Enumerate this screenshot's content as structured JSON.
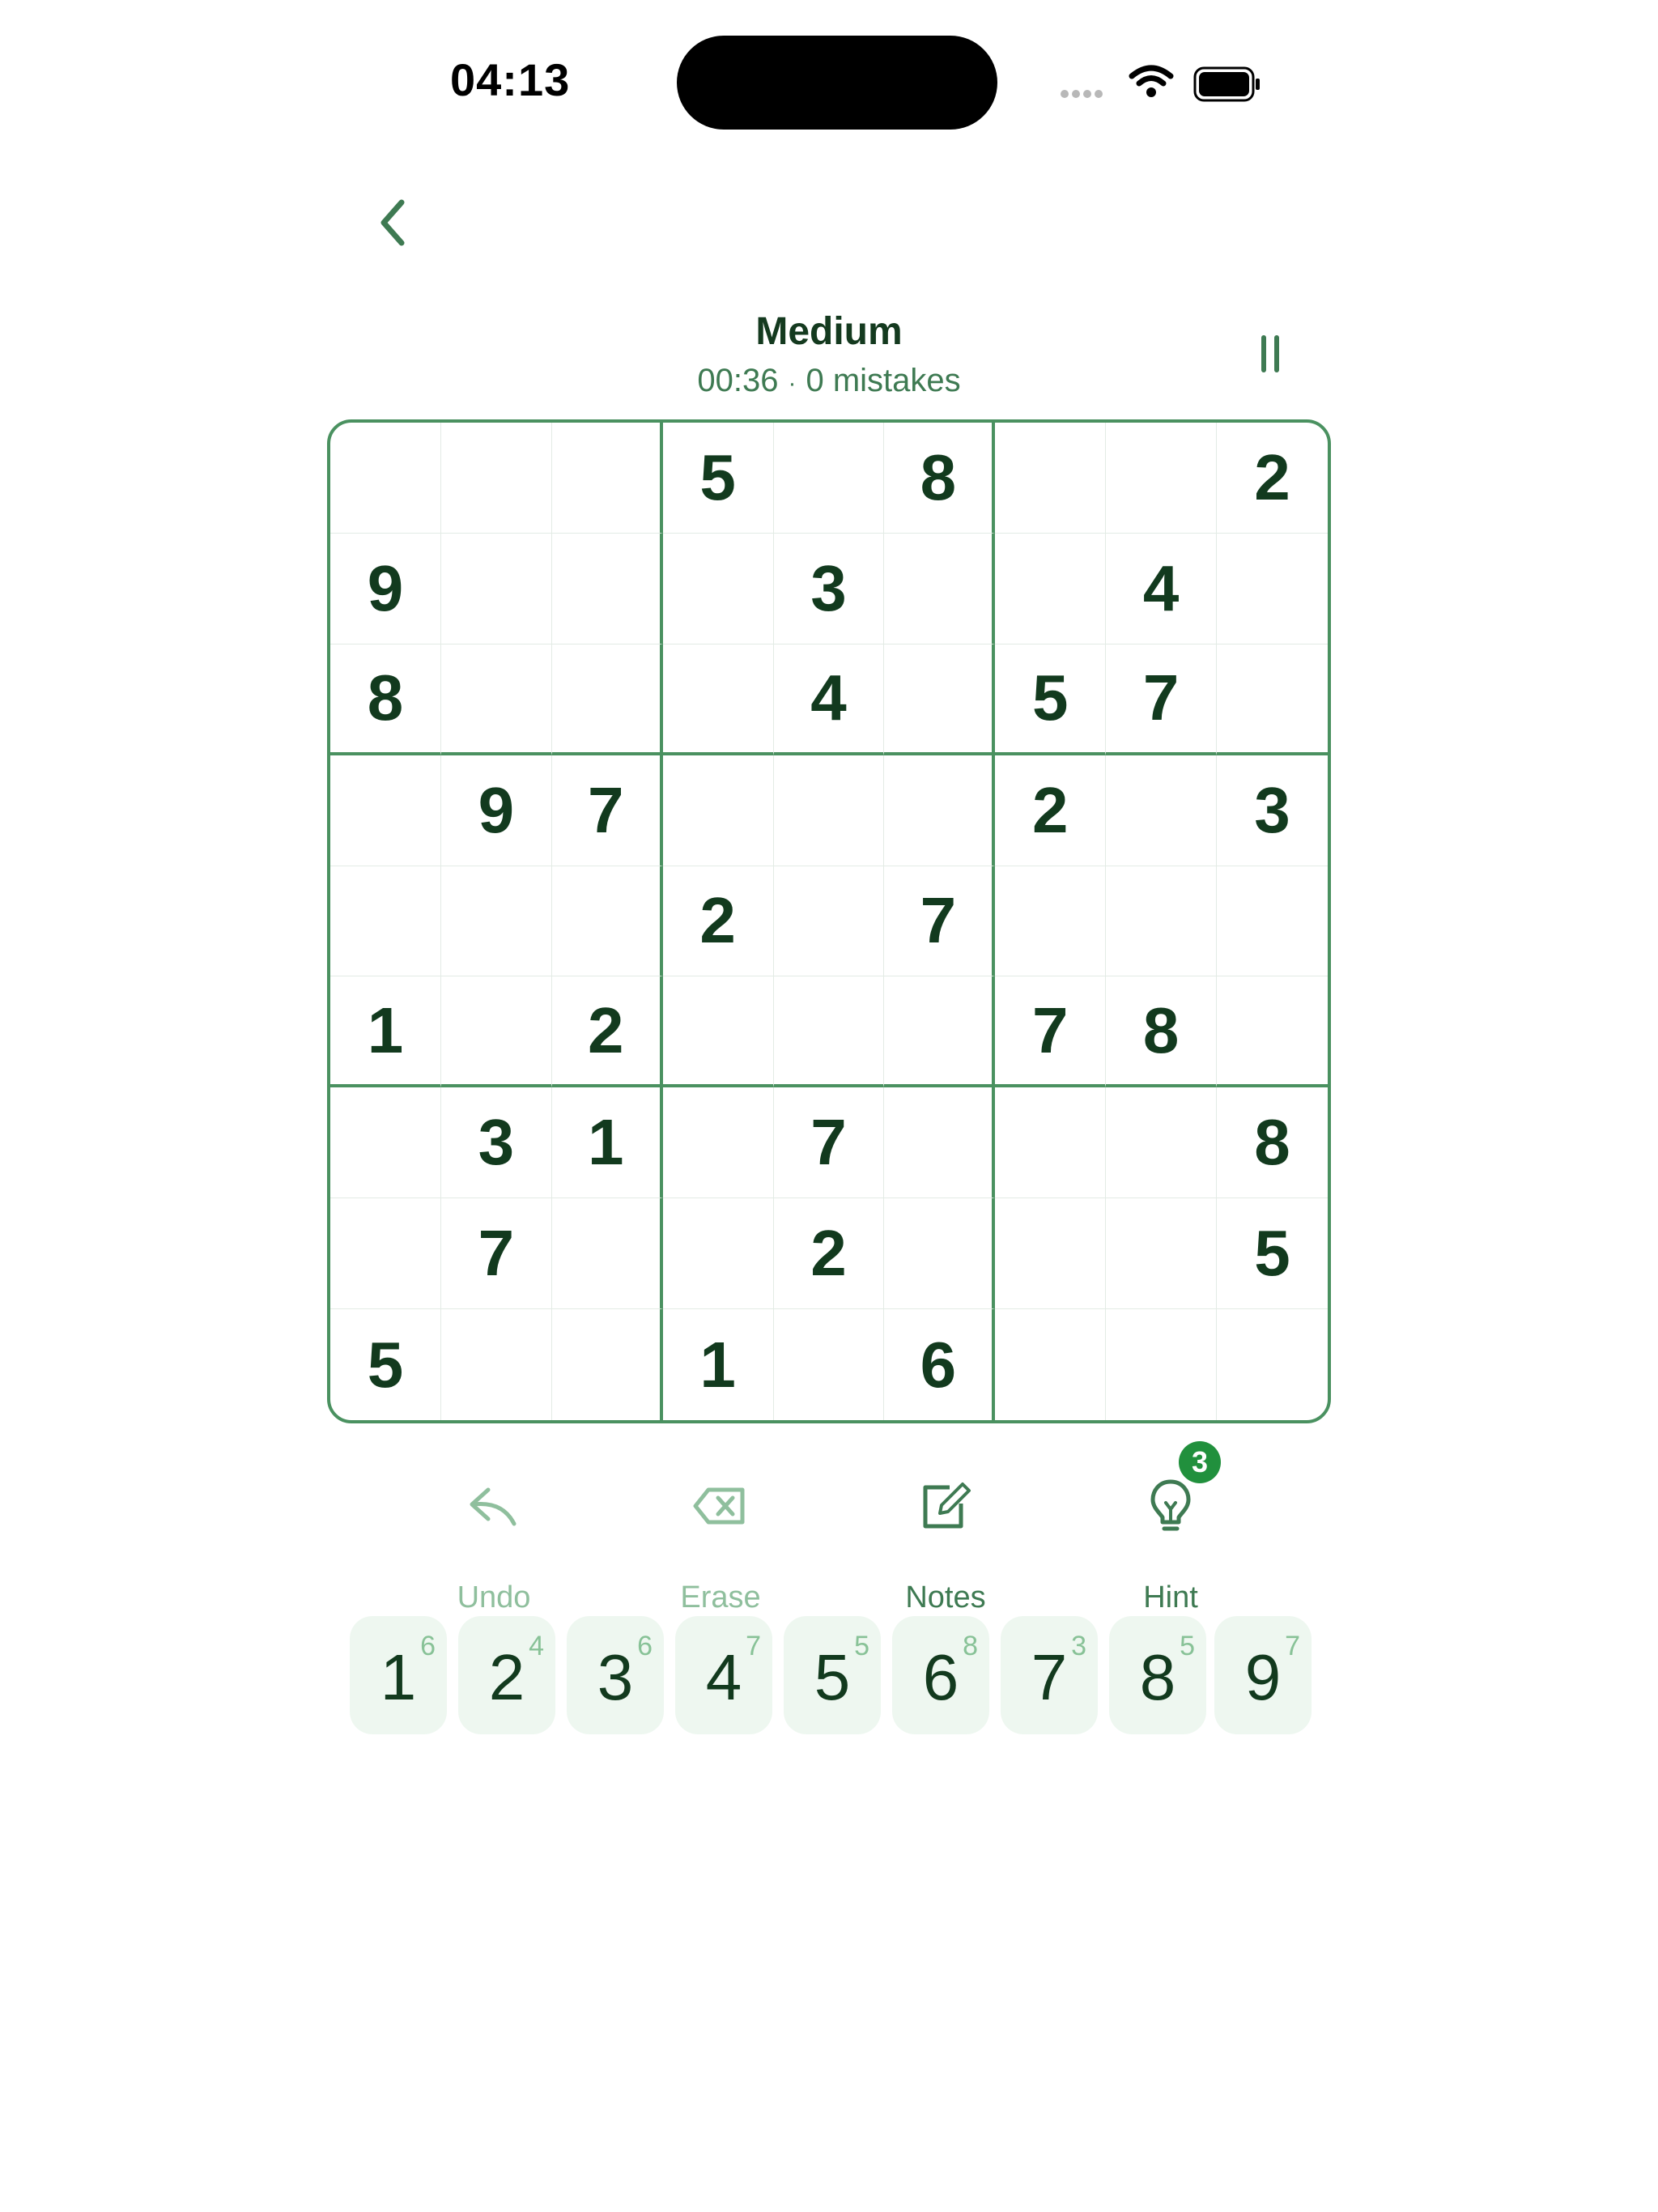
{
  "status_bar": {
    "time": "04:13"
  },
  "header": {
    "difficulty": "Medium",
    "timer": "00:36",
    "separator": "·",
    "mistakes": "0 mistakes"
  },
  "board": [
    [
      "",
      "",
      "",
      "5",
      "",
      "8",
      "",
      "",
      "2"
    ],
    [
      "9",
      "",
      "",
      "",
      "3",
      "",
      "",
      "4",
      ""
    ],
    [
      "8",
      "",
      "",
      "",
      "4",
      "",
      "5",
      "7",
      ""
    ],
    [
      "",
      "9",
      "7",
      "",
      "",
      "",
      "2",
      "",
      "3"
    ],
    [
      "",
      "",
      "",
      "2",
      "",
      "7",
      "",
      "",
      ""
    ],
    [
      "1",
      "",
      "2",
      "",
      "",
      "",
      "7",
      "8",
      ""
    ],
    [
      "",
      "3",
      "1",
      "",
      "7",
      "",
      "",
      "",
      "8"
    ],
    [
      "",
      "7",
      "",
      "",
      "2",
      "",
      "",
      "",
      "5"
    ],
    [
      "5",
      "",
      "",
      "1",
      "",
      "6",
      "",
      "",
      ""
    ]
  ],
  "tools": {
    "undo": {
      "label": "Undo",
      "icon": "undo-arrow-icon"
    },
    "erase": {
      "label": "Erase",
      "icon": "eraser-icon"
    },
    "notes": {
      "label": "Notes",
      "icon": "pencil-note-icon"
    },
    "hint": {
      "label": "Hint",
      "icon": "lightbulb-icon",
      "remaining": "3"
    }
  },
  "numpad": [
    {
      "digit": "1",
      "remaining": "6"
    },
    {
      "digit": "2",
      "remaining": "4"
    },
    {
      "digit": "3",
      "remaining": "6"
    },
    {
      "digit": "4",
      "remaining": "7"
    },
    {
      "digit": "5",
      "remaining": "5"
    },
    {
      "digit": "6",
      "remaining": "8"
    },
    {
      "digit": "7",
      "remaining": "3"
    },
    {
      "digit": "8",
      "remaining": "5"
    },
    {
      "digit": "9",
      "remaining": "7"
    }
  ],
  "colors": {
    "accent": "#4a9160",
    "text_dark": "#123a1e",
    "badge": "#21903d",
    "key_bg": "#eef7f0",
    "disabled": "#8fbf9d"
  }
}
